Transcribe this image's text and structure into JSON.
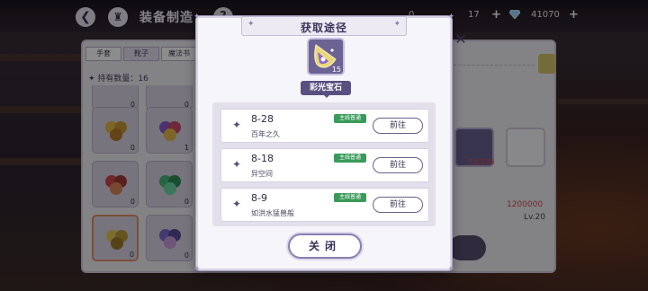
{
  "topbar": {
    "title": "装备制造",
    "back_icon": "back-arrow-icon",
    "home_icon": "castle-home-icon",
    "help_label": "?",
    "resource_1_partial": "0",
    "resource_2": "17",
    "resource_3": "41070",
    "plus": "+"
  },
  "underlying": {
    "tabs": [
      "手套",
      "靴子",
      "魔法书"
    ],
    "held_label": "✦ 持有数量：16",
    "slot_counts": [
      "0",
      "0",
      "0",
      "1",
      "0",
      "0",
      "0",
      "0"
    ],
    "material_count": "15/120",
    "price": "1200000",
    "level": "Lv.20"
  },
  "dialog": {
    "title": "获取途径",
    "item": {
      "name": "彩光宝石",
      "count": "15"
    },
    "routes": [
      {
        "stage": "8-28",
        "subtitle": "百年之久",
        "tag": "主线普通",
        "button": "前往"
      },
      {
        "stage": "8-18",
        "subtitle": "异空间",
        "tag": "主线普通",
        "button": "前往"
      },
      {
        "stage": "8-9",
        "subtitle": "如洪水猛兽般",
        "tag": "主线普通",
        "button": "前往"
      }
    ],
    "close_label": "关闭"
  },
  "colors": {
    "accent": "#5a4f80",
    "tag_green": "#3a9a5a",
    "price_red": "#d04a4a"
  }
}
